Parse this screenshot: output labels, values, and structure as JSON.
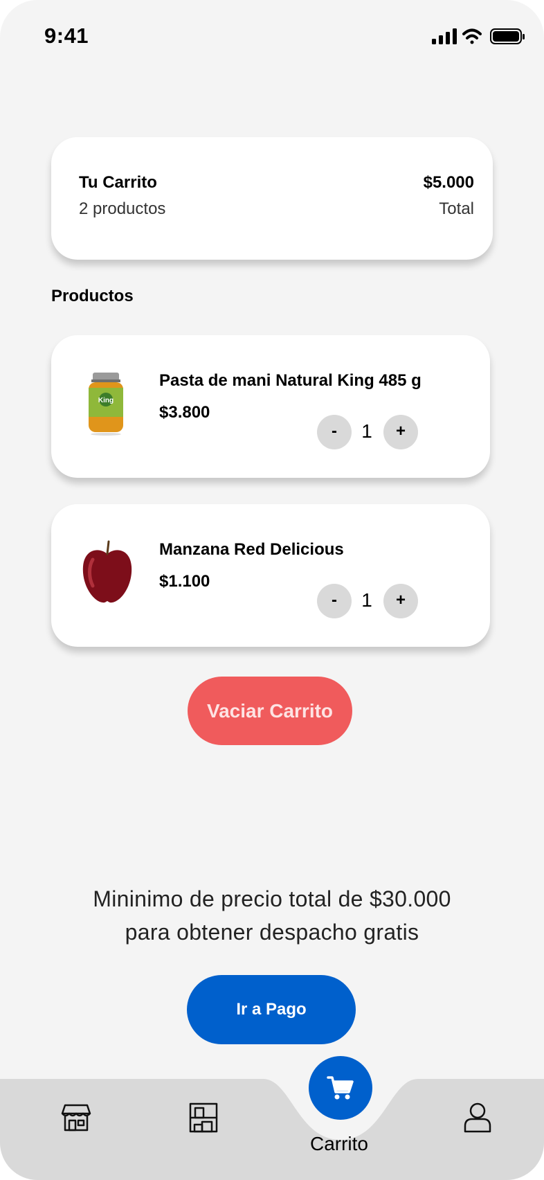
{
  "status_bar": {
    "time": "9:41"
  },
  "summary": {
    "title": "Tu Carrito",
    "count_text": "2 productos",
    "total_amount": "$5.000",
    "total_label": "Total"
  },
  "section_title": "Productos",
  "products": [
    {
      "name": "Pasta de mani Natural King 485 g",
      "price": "$3.800",
      "quantity": "1",
      "minus": "-",
      "plus": "+",
      "image_label": "King"
    },
    {
      "name": "Manzana Red Delicious",
      "price": "$1.100",
      "quantity": "1",
      "minus": "-",
      "plus": "+"
    }
  ],
  "empty_cart_label": "Vaciar Carrito",
  "shipping_note": {
    "line1": "Mininimo de precio total de $30.000",
    "line2": "para obtener despacho gratis"
  },
  "pay_button_label": "Ir a Pago",
  "nav": {
    "items": [
      {
        "icon": "store-icon"
      },
      {
        "icon": "shelves-icon"
      },
      {
        "icon": "cart-icon",
        "label": "Carrito",
        "active": true
      },
      {
        "icon": "user-icon"
      }
    ]
  },
  "colors": {
    "background": "#f4f4f4",
    "accent_blue": "#0060cc",
    "danger_red": "#f05b5c",
    "nav_gray": "#d9d9d9"
  }
}
